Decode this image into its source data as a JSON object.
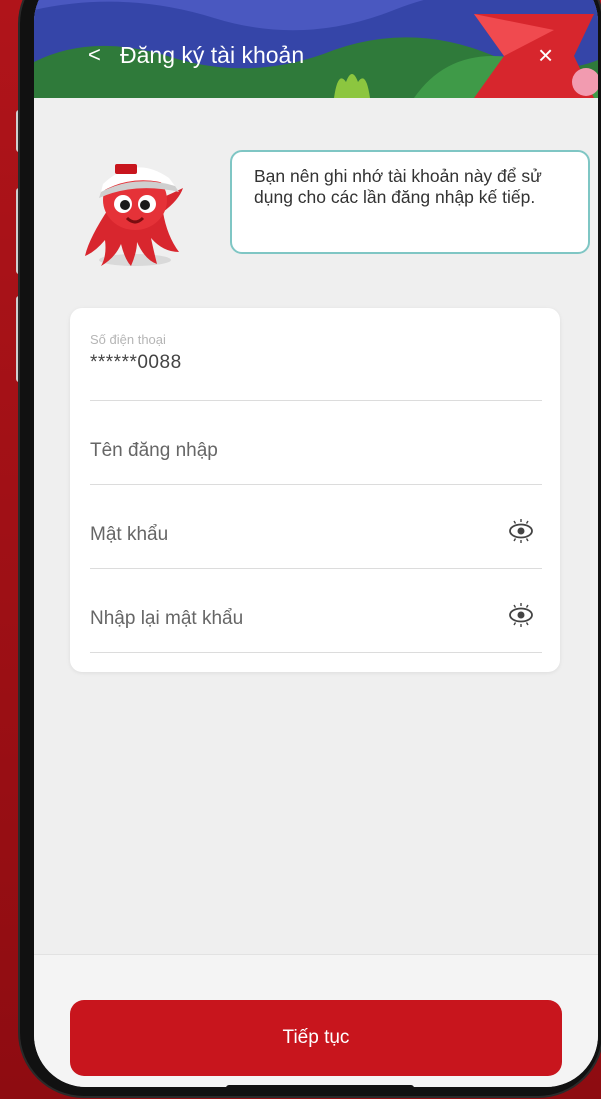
{
  "header": {
    "back_icon": "chevron-left-icon",
    "back_glyph": "<",
    "title": "Đăng ký tài khoản",
    "close_icon": "close-icon",
    "close_glyph": "×"
  },
  "mascot": {
    "icon": "octopus-mascot-icon"
  },
  "tip": {
    "text": "Bạn nên ghi nhớ tài khoản này để sử dụng cho các lần đăng nhập kế tiếp."
  },
  "form": {
    "phone": {
      "label": "Số điện thoại",
      "value": "******0088"
    },
    "username": {
      "placeholder": "Tên đăng nhập"
    },
    "password": {
      "placeholder": "Mật khẩu",
      "icon": "eye-icon"
    },
    "confirm_password": {
      "placeholder": "Nhập lại mật khẩu",
      "icon": "eye-icon"
    }
  },
  "actions": {
    "continue_label": "Tiếp tục"
  },
  "colors": {
    "brand_red": "#c8151d",
    "bubble_border": "#7fc6c4",
    "header_blue": "#2f3f9e",
    "header_green": "#2f7a3a"
  }
}
